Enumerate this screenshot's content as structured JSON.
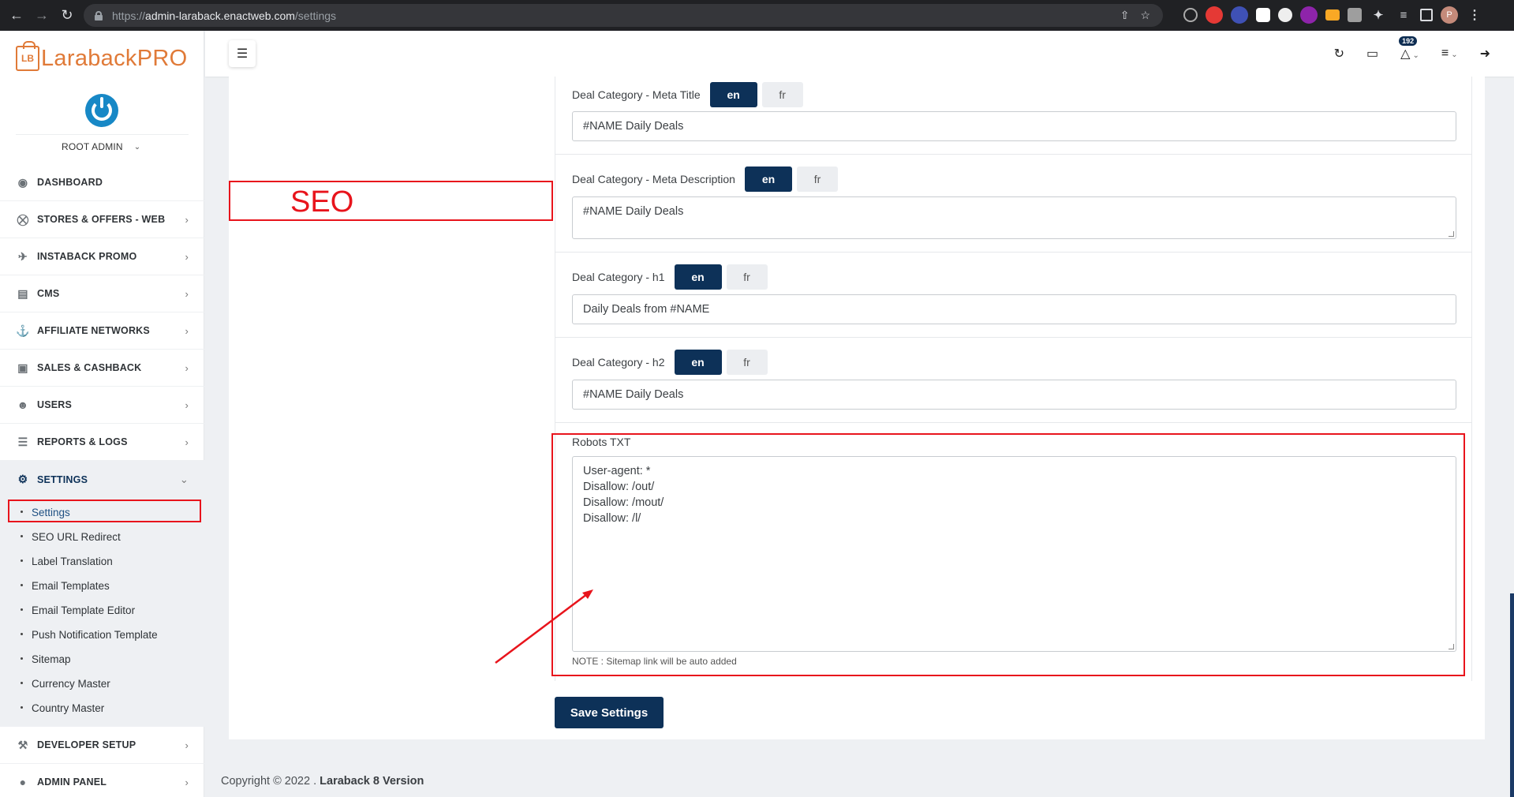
{
  "browser": {
    "url_scheme": "https://",
    "url_host": "admin-laraback.enactweb.com",
    "url_path": "/settings",
    "profile_initial": "P"
  },
  "sidebar": {
    "logo_badge": "LB",
    "logo_text": "LarabackPRO",
    "user_name": "ROOT ADMIN",
    "menu": [
      {
        "label": "DASHBOARD",
        "icon": "dashboard-icon"
      },
      {
        "label": "STORES & OFFERS - WEB",
        "icon": "cart-icon"
      },
      {
        "label": "INSTABACK PROMO",
        "icon": "plane-icon"
      },
      {
        "label": "CMS",
        "icon": "cms-icon"
      },
      {
        "label": "AFFILIATE NETWORKS",
        "icon": "anchor-icon"
      },
      {
        "label": "SALES & CASHBACK",
        "icon": "money-icon"
      },
      {
        "label": "USERS",
        "icon": "users-icon"
      },
      {
        "label": "REPORTS & LOGS",
        "icon": "list-icon"
      },
      {
        "label": "SETTINGS",
        "icon": "gears-icon"
      }
    ],
    "settings_sub": [
      "Settings",
      "SEO URL Redirect",
      "Label Translation",
      "Email Templates",
      "Email Template Editor",
      "Push Notification Template",
      "Sitemap",
      "Currency Master",
      "Country Master"
    ],
    "menu_after": [
      {
        "label": "DEVELOPER SETUP",
        "icon": "wrench-icon"
      },
      {
        "label": "ADMIN PANEL",
        "icon": "admin-icon"
      }
    ]
  },
  "topbar": {
    "notification_count": "192"
  },
  "annotation": {
    "seo_label": "SEO"
  },
  "fields": {
    "lang_en": "en",
    "lang_fr": "fr",
    "meta_title_label": "Deal Category - Meta Title",
    "meta_title_value": "#NAME Daily Deals",
    "meta_desc_label": "Deal Category - Meta Description",
    "meta_desc_value": "#NAME Daily Deals",
    "h1_label": "Deal Category - h1",
    "h1_value": "Daily Deals from #NAME",
    "h2_label": "Deal Category - h2",
    "h2_value": "#NAME Daily Deals",
    "robots_label": "Robots TXT",
    "robots_lines": [
      "User-agent: *",
      "Disallow: /out/",
      "Disallow: /mout/",
      "Disallow: /l/"
    ],
    "robots_note": "NOTE : Sitemap link will be auto added"
  },
  "save_label": "Save Settings",
  "footer": {
    "copyright": "Copyright © 2022 .",
    "version": "Laraback 8 Version"
  },
  "colors": {
    "primary": "#0d3158",
    "annotation_red": "#e8141c",
    "logo_orange": "#e07a38"
  }
}
